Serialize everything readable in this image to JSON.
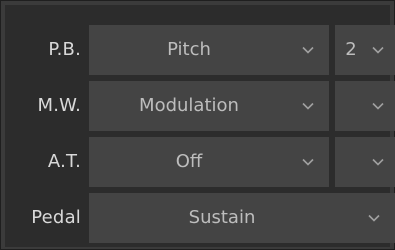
{
  "rows": [
    {
      "label": "P.B.",
      "value": "Pitch",
      "secondary": "2"
    },
    {
      "label": "M.W.",
      "value": "Modulation",
      "secondary": ""
    },
    {
      "label": "A.T.",
      "value": "Off",
      "secondary": ""
    },
    {
      "label": "Pedal",
      "value": "Sustain"
    }
  ],
  "icons": {
    "dropdown": "chevron-down-icon"
  },
  "colors": {
    "panel_background": "#2c2c2c",
    "field_background": "#444444",
    "label_text": "#d9d9d9",
    "value_text": "#bdbdbd"
  }
}
